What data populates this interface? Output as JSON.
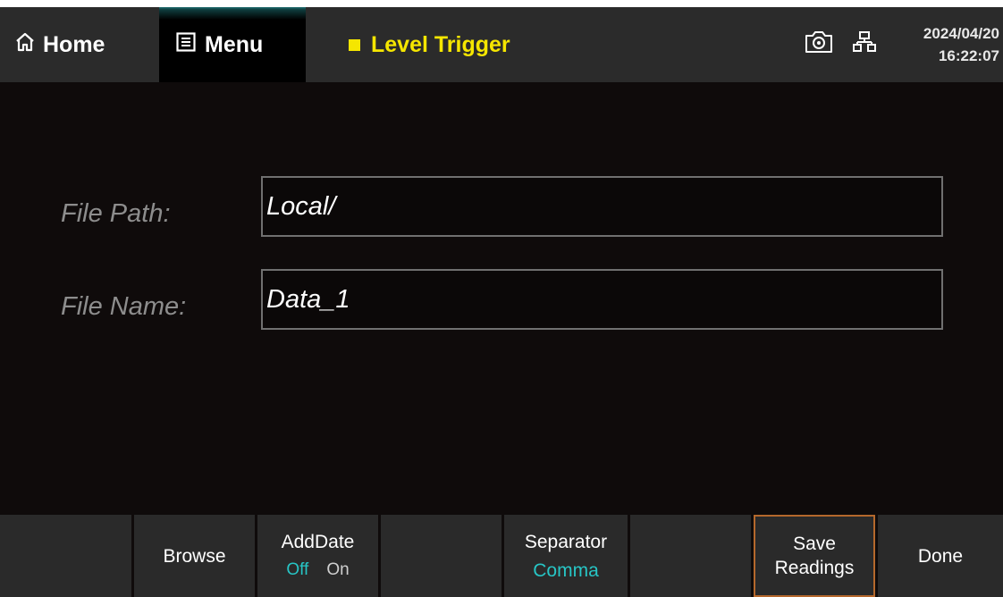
{
  "header": {
    "home_label": "Home",
    "menu_label": "Menu",
    "trigger_label": "Level Trigger",
    "date": "2024/04/20",
    "time": "16:22:07"
  },
  "form": {
    "file_path_label": "File Path:",
    "file_path_value": "Local/",
    "file_name_label": "File Name:",
    "file_name_value": "Data_1"
  },
  "softkeys": {
    "browse": "Browse",
    "add_date": {
      "title": "AddDate",
      "off": "Off",
      "on": "On",
      "selected": "Off"
    },
    "separator": {
      "title": "Separator",
      "value": "Comma"
    },
    "save_readings_line1": "Save",
    "save_readings_line2": "Readings",
    "done": "Done"
  },
  "colors": {
    "accent_yellow": "#f5e600",
    "accent_teal": "#27c5c5",
    "highlight_orange": "#b5682c"
  }
}
